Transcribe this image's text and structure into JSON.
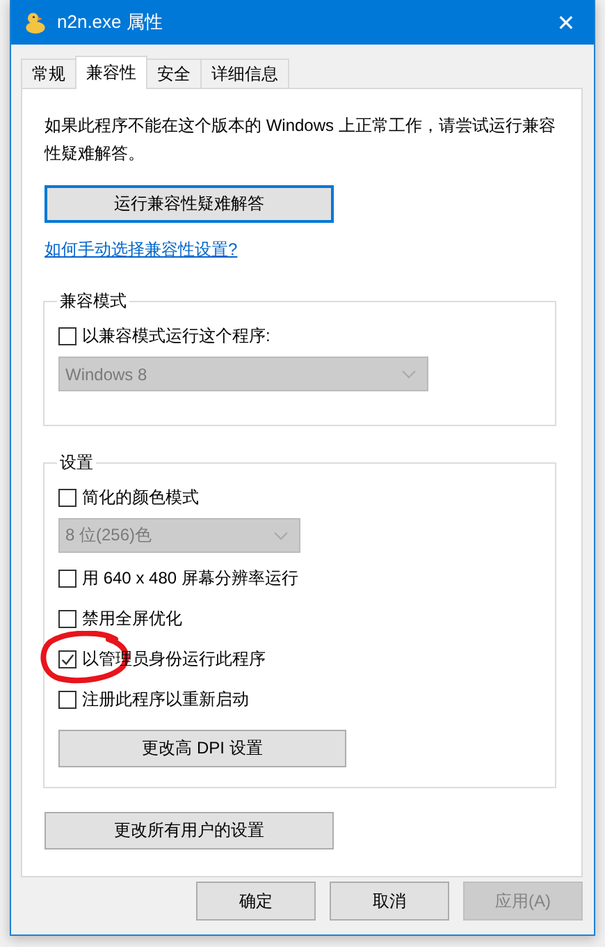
{
  "window": {
    "title": "n2n.exe 属性",
    "close": "✕"
  },
  "tabs": [
    {
      "label": "常规",
      "selected": false
    },
    {
      "label": "兼容性",
      "selected": true
    },
    {
      "label": "安全",
      "selected": false
    },
    {
      "label": "详细信息",
      "selected": false
    }
  ],
  "intro": "如果此程序不能在这个版本的 Windows 上正常工作，请尝试运行兼容性疑难解答。",
  "troubleshoot_button": "运行兼容性疑难解答",
  "help_link": "如何手动选择兼容性设置?",
  "groups": [
    {
      "title": "兼容模式",
      "items": [
        {
          "kind": "checkbox",
          "label": "以兼容模式运行这个程序:",
          "checked": false,
          "highlighted": false
        },
        {
          "kind": "dropdown",
          "value": "Windows 8",
          "disabled": true
        }
      ]
    },
    {
      "title": "设置",
      "items": [
        {
          "kind": "checkbox",
          "label": "简化的颜色模式",
          "checked": false,
          "highlighted": false
        },
        {
          "kind": "dropdown",
          "value": "8 位(256)色",
          "disabled": true
        },
        {
          "kind": "checkbox",
          "label": "用 640 x 480 屏幕分辨率运行",
          "checked": false,
          "highlighted": false
        },
        {
          "kind": "checkbox",
          "label": "禁用全屏优化",
          "checked": false,
          "highlighted": false
        },
        {
          "kind": "checkbox",
          "label": "以管理员身份运行此程序",
          "checked": true,
          "highlighted": true
        },
        {
          "kind": "checkbox",
          "label": "注册此程序以重新启动",
          "checked": false,
          "highlighted": false
        },
        {
          "kind": "button",
          "label": "更改高 DPI 设置"
        }
      ]
    }
  ],
  "all_users_button": "更改所有用户的设置",
  "buttons": [
    {
      "label": "确定",
      "disabled": false
    },
    {
      "label": "取消",
      "disabled": false
    },
    {
      "label": "应用(A)",
      "disabled": true
    }
  ]
}
